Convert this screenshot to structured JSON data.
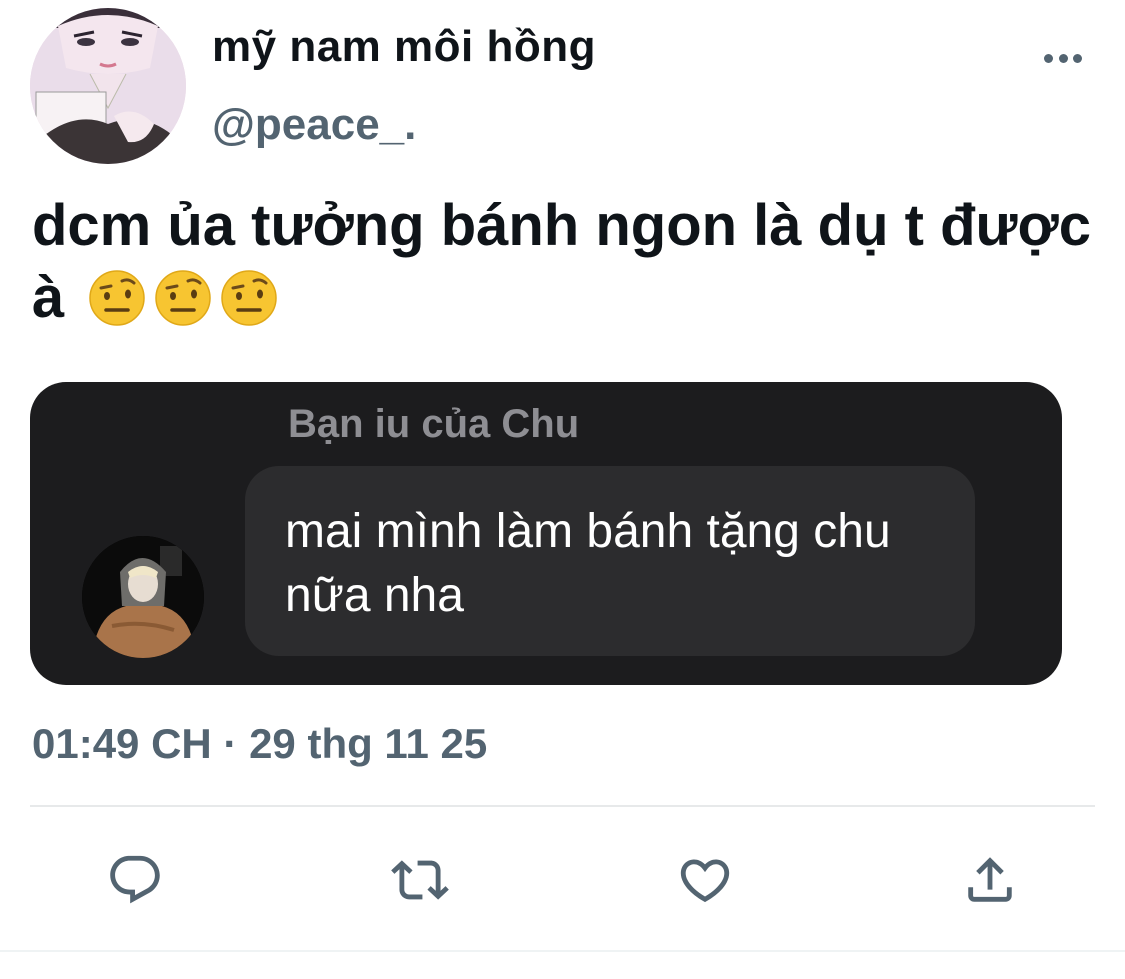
{
  "author": {
    "display_name": "mỹ nam môi hồng",
    "handle": "@peace_.",
    "avatar_icon": "profile-avatar-illustration"
  },
  "tweet": {
    "text": "dcm ủa tưởng bánh ngon là dụ t được à",
    "emojis": [
      "face-with-raised-eyebrow",
      "face-with-raised-eyebrow",
      "face-with-raised-eyebrow"
    ],
    "timestamp": "01:49 CH · 29 thg 11 25"
  },
  "media": {
    "sender_name": "Bạn iu của Chu",
    "message": "mai mình làm bánh tặng chu nữa nha",
    "avatar_icon": "person-in-hoodie-avatar"
  },
  "actions": [
    {
      "name": "reply",
      "icon": "reply-icon"
    },
    {
      "name": "retweet",
      "icon": "retweet-icon"
    },
    {
      "name": "like",
      "icon": "heart-icon"
    },
    {
      "name": "share",
      "icon": "share-icon"
    }
  ],
  "colors": {
    "text": "#0f1419",
    "secondary": "#536471",
    "card_bg": "#1c1c1e",
    "bubble_bg": "#2c2c2e"
  }
}
